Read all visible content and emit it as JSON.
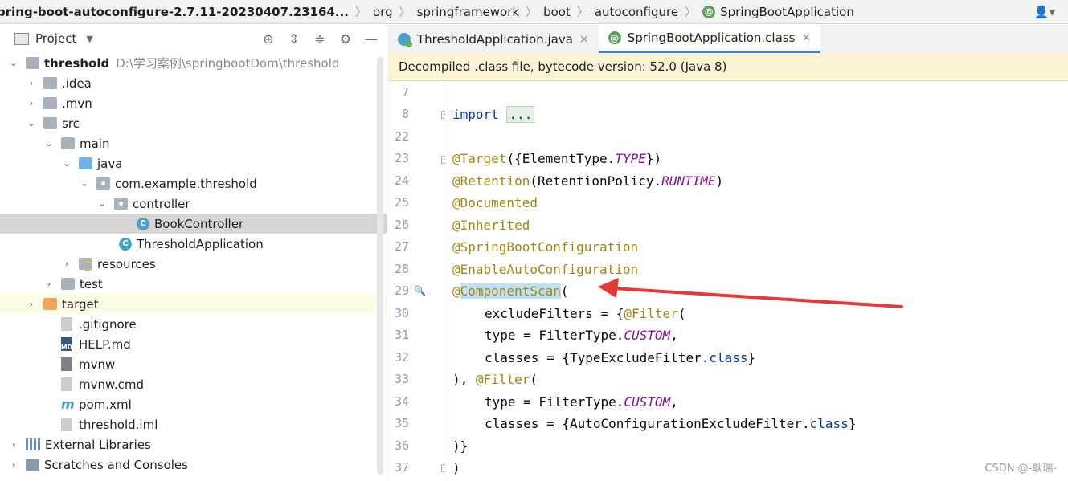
{
  "breadcrumb": {
    "items": [
      "pring-boot-autoconfigure-2.7.11-20230407.23164...",
      "org",
      "springframework",
      "boot",
      "autoconfigure",
      "SpringBootApplication"
    ]
  },
  "project_panel": {
    "title": "Project",
    "tree": [
      {
        "label": "threshold",
        "path": "D:\\学习案例\\springbootDom\\threshold"
      },
      {
        "label": ".idea"
      },
      {
        "label": ".mvn"
      },
      {
        "label": "src"
      },
      {
        "label": "main"
      },
      {
        "label": "java"
      },
      {
        "label": "com.example.threshold"
      },
      {
        "label": "controller"
      },
      {
        "label": "BookController"
      },
      {
        "label": "ThresholdApplication"
      },
      {
        "label": "resources"
      },
      {
        "label": "test"
      },
      {
        "label": "target"
      },
      {
        "label": ".gitignore"
      },
      {
        "label": "HELP.md"
      },
      {
        "label": "mvnw"
      },
      {
        "label": "mvnw.cmd"
      },
      {
        "label": "pom.xml"
      },
      {
        "label": "threshold.iml"
      },
      {
        "label": "External Libraries"
      },
      {
        "label": "Scratches and Consoles"
      }
    ]
  },
  "tabs": [
    {
      "label": "ThresholdApplication.java"
    },
    {
      "label": "SpringBootApplication.class"
    }
  ],
  "banner": "Decompiled .class file, bytecode version: 52.0 (Java 8)",
  "code": {
    "line_numbers": [
      "7",
      "8",
      "22",
      "23",
      "24",
      "25",
      "26",
      "27",
      "28",
      "29",
      "30",
      "31",
      "32",
      "33",
      "34",
      "35",
      "36",
      "37"
    ],
    "import_kw": "import",
    "import_dots": "...",
    "l23_a": "@Target",
    "l23_b": "({ElementType.",
    "l23_c": "TYPE",
    "l23_d": "})",
    "l24_a": "@Retention",
    "l24_b": "(RetentionPolicy.",
    "l24_c": "RUNTIME",
    "l24_d": ")",
    "l25": "@Documented",
    "l26": "@Inherited",
    "l27": "@SpringBootConfiguration",
    "l28": "@EnableAutoConfiguration",
    "l29_a": "@",
    "l29_b": "ComponentScan",
    "l29_c": "(",
    "l30_a": "excludeFilters = {",
    "l30_b": "@Filter",
    "l30_c": "(",
    "l31_a": "type = FilterType.",
    "l31_b": "CUSTOM",
    "l31_c": ",",
    "l32_a": "classes = {TypeExcludeFilter.",
    "l32_b": "class",
    "l32_c": "}",
    "l33_a": "), ",
    "l33_b": "@Filter",
    "l33_c": "(",
    "l34_a": "type = FilterType.",
    "l34_b": "CUSTOM",
    "l34_c": ",",
    "l35_a": "classes = {AutoConfigurationExcludeFilter.",
    "l35_b": "class",
    "l35_c": "}",
    "l36": ")}",
    "l37": ")"
  },
  "watermark": "CSDN @-耿瑞-",
  "colors": {
    "annotation": "#9e880d",
    "keyword": "#0033b3",
    "constant": "#871094",
    "arrow": "#e53935",
    "selection": "#d5d5d5"
  }
}
